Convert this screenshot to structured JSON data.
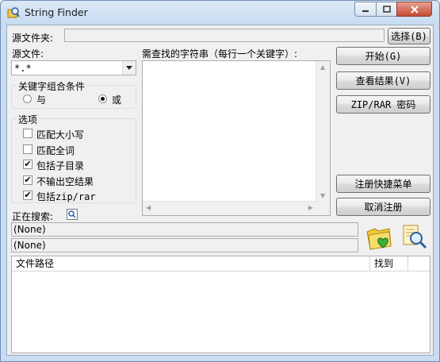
{
  "window": {
    "title": "String Finder",
    "icon": "magnifier-folder-icon"
  },
  "source_folder": {
    "label": "源文件夹:",
    "value": "",
    "browse_label": "选择(B)"
  },
  "source_files": {
    "label": "源文件:",
    "value": "*.*"
  },
  "keyword_condition": {
    "title": "关键字组合条件",
    "options": [
      "与",
      "或"
    ],
    "selected": "或"
  },
  "options": {
    "title": "选项",
    "items": [
      {
        "label": "匹配大小写",
        "checked": false
      },
      {
        "label": "匹配全词",
        "checked": false
      },
      {
        "label": "包括子目录",
        "checked": true
      },
      {
        "label": "不输出空结果",
        "checked": true
      },
      {
        "label": "包括zip/rar",
        "checked": true
      }
    ]
  },
  "search_strings": {
    "label": "需查找的字符串（每行一个关键字）:",
    "value": ""
  },
  "buttons": {
    "start": "开始(G)",
    "view_results": "查看结果(V)",
    "zip_password": "ZIP/RAR 密码",
    "register_menu": "注册快捷菜单",
    "unregister": "取消注册"
  },
  "status": {
    "searching_label": "正在搜索:",
    "line1": "(None)",
    "line2": "(None)"
  },
  "results": {
    "columns": [
      "文件路径",
      "找到"
    ],
    "rows": []
  }
}
